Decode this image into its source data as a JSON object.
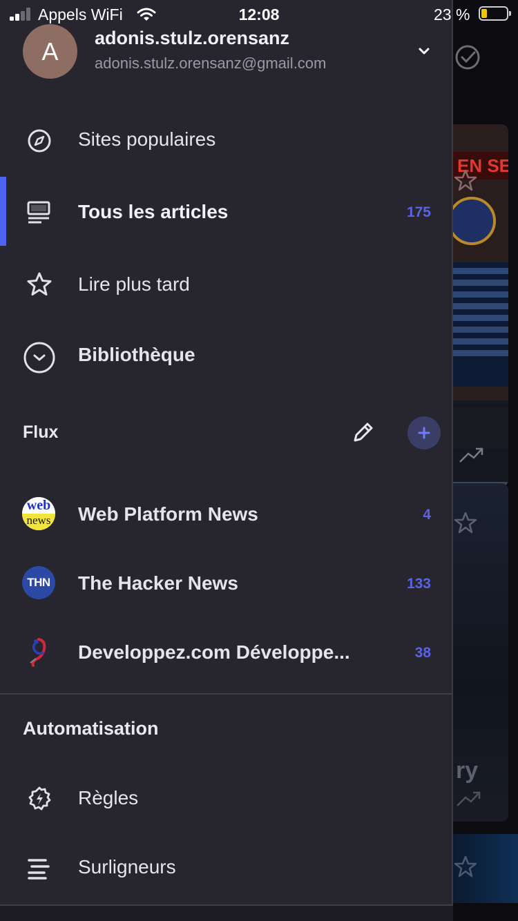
{
  "status_bar": {
    "carrier": "Appels WiFi",
    "time": "12:08",
    "battery": "23 %",
    "icons": [
      "signal-icon",
      "wifi-icon",
      "battery-icon"
    ]
  },
  "account": {
    "avatar_letter": "A",
    "name": "adonis.stulz.orensanz",
    "email": "adonis.stulz.orensanz@gmail.com"
  },
  "nav": [
    {
      "label": "Sites populaires",
      "icon": "compass-icon",
      "count": ""
    },
    {
      "label": "Tous les articles",
      "icon": "articles-icon",
      "count": "175",
      "active": true
    },
    {
      "label": "Lire plus tard",
      "icon": "star-icon",
      "count": ""
    },
    {
      "label": "Bibliothèque",
      "icon": "library-icon",
      "count": ""
    }
  ],
  "feeds_section": {
    "title": "Flux",
    "edit_icon": "pencil-icon",
    "add_icon": "plus-icon"
  },
  "feeds": [
    {
      "label": "Web Platform News",
      "count": "4",
      "icon": "web-platform-news-logo",
      "logo_top": "web",
      "logo_bottom": "news"
    },
    {
      "label": "The Hacker News",
      "count": "133",
      "icon": "the-hacker-news-logo",
      "logo_text": "THN"
    },
    {
      "label": "Developpez.com Développe...",
      "count": "38",
      "icon": "developpez-logo"
    }
  ],
  "automation_section": {
    "title": "Automatisation",
    "items": [
      {
        "label": "Règles",
        "icon": "rules-icon"
      },
      {
        "label": "Surligneurs",
        "icon": "highlighters-icon"
      }
    ]
  },
  "background": {
    "banner_text": "EN SE",
    "partial_text": "ry"
  },
  "colors": {
    "drawer_bg": "#27262f",
    "accent": "#4f62f0",
    "count": "#5a63e6",
    "avatar": "#8e6e63"
  }
}
